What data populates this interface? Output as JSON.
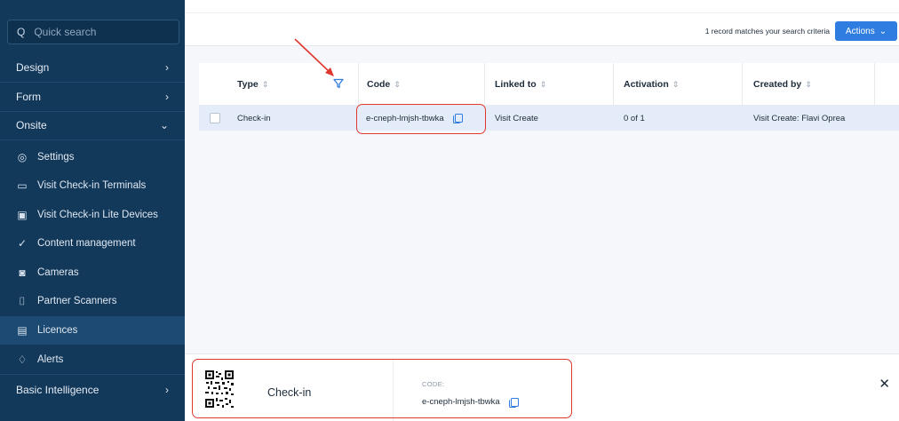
{
  "sidebar": {
    "search_placeholder": "Quick search",
    "sections": [
      {
        "label": "Design",
        "chev": "›"
      },
      {
        "label": "Form",
        "chev": "›"
      },
      {
        "label": "Onsite",
        "chev": "⌄"
      },
      {
        "label": "Basic Intelligence",
        "chev": "›"
      }
    ],
    "items": [
      {
        "label": "Settings",
        "icon": "location-pin-icon",
        "glyph": "◎"
      },
      {
        "label": "Visit Check-in Terminals",
        "icon": "laptop-icon",
        "glyph": "▭"
      },
      {
        "label": "Visit Check-in Lite Devices",
        "icon": "tablet-icon",
        "glyph": "▣"
      },
      {
        "label": "Content management",
        "icon": "check-icon",
        "glyph": "✓"
      },
      {
        "label": "Cameras",
        "icon": "camera-icon",
        "glyph": "◙"
      },
      {
        "label": "Partner Scanners",
        "icon": "scanner-icon",
        "glyph": "⌷"
      },
      {
        "label": "Licences",
        "icon": "clipboard-icon",
        "glyph": "▤"
      },
      {
        "label": "Alerts",
        "icon": "bell-icon",
        "glyph": "♢"
      }
    ]
  },
  "toolbar": {
    "match_text": "1 record matches your search criteria",
    "actions_label": "Actions",
    "actions_chev": "⌄"
  },
  "table": {
    "columns": [
      {
        "label": "Type",
        "sort": "⇕"
      },
      {
        "label": "Code",
        "sort": "⇕"
      },
      {
        "label": "Linked to",
        "sort": "⇕"
      },
      {
        "label": "Activation",
        "sort": "⇕"
      },
      {
        "label": "Created by",
        "sort": "⇕"
      }
    ],
    "rows": [
      {
        "type": "Check-in",
        "code": "e-cneph-lmjsh-tbwka",
        "linked_to": "Visit Create",
        "activation": "0 of 1",
        "created_by": "Visit Create: Flavi Oprea"
      }
    ]
  },
  "drawer": {
    "title": "Check-in",
    "code_label": "CODE:",
    "code_value": "e-cneph-lmjsh-tbwka",
    "close_glyph": "✕"
  },
  "colors": {
    "sidebar_bg": "#12385a",
    "accent": "#2f7de1",
    "annotation_red": "#e0372f",
    "row_selected": "#e3ecf8"
  }
}
